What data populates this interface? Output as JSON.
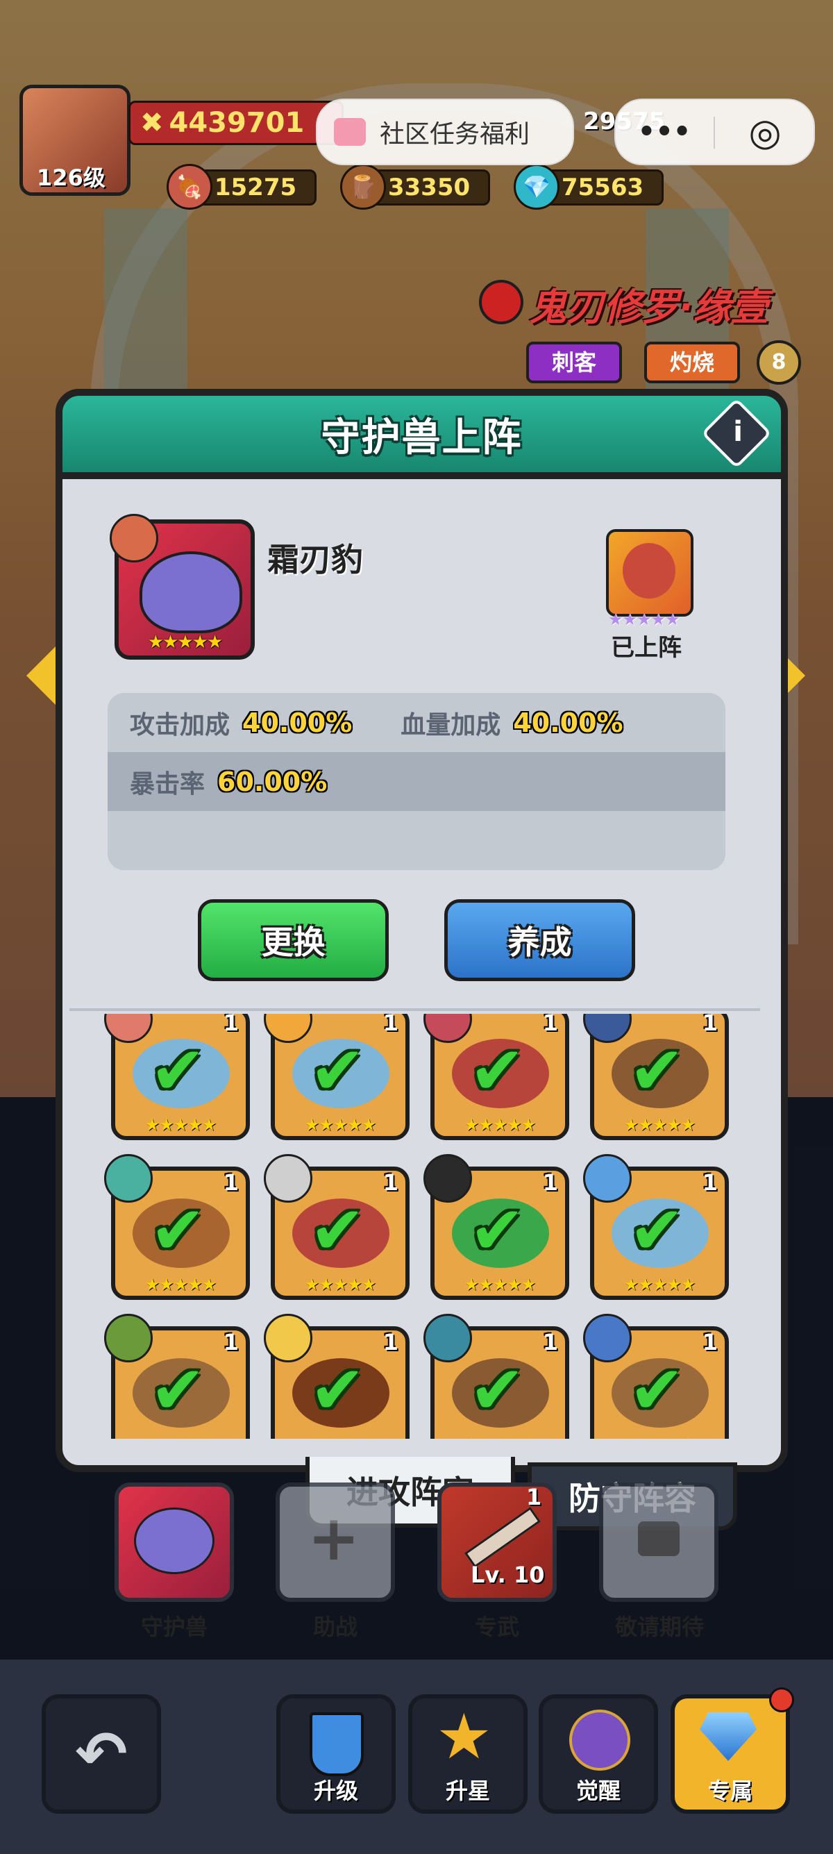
{
  "hud": {
    "level": "126级",
    "power": "4439701",
    "extra_value": "29575",
    "resources": [
      {
        "icon": "meat-icon",
        "value": "15275"
      },
      {
        "icon": "wood-log-icon",
        "value": "33350"
      },
      {
        "icon": "crystal-icon",
        "value": "75563"
      }
    ]
  },
  "capsule": {
    "title": "社区任务福利",
    "more": "•••",
    "close": "◎"
  },
  "hero": {
    "name": "鬼刃修罗·缘壹",
    "tags": [
      "刺客",
      "灼烧"
    ],
    "rank": "8"
  },
  "modal": {
    "title": "守护兽上阵",
    "info": "i",
    "beast": {
      "name": "霜刃豹",
      "stars": "★★★★★"
    },
    "deployed": {
      "label": "已上阵",
      "stars": "★★★★★"
    },
    "stats": [
      {
        "label": "攻击加成",
        "value": "40.00%"
      },
      {
        "label": "血量加成",
        "value": "40.00%"
      },
      {
        "label": "暴击率",
        "value": "60.00%"
      }
    ],
    "buttons": {
      "replace": "更换",
      "train": "养成"
    }
  },
  "grid": {
    "items": [
      {
        "monster": "blue-slug",
        "level": "1"
      },
      {
        "monster": "blue-slug",
        "level": "1"
      },
      {
        "monster": "red-lizard",
        "level": "1"
      },
      {
        "monster": "tree-stump",
        "level": "1"
      },
      {
        "monster": "boar",
        "level": "1"
      },
      {
        "monster": "red-lizard",
        "level": "1"
      },
      {
        "monster": "green-slime",
        "level": "1"
      },
      {
        "monster": "blue-slug",
        "level": "1"
      },
      {
        "monster": "owl",
        "level": "1"
      },
      {
        "monster": "beetle",
        "level": "1"
      },
      {
        "monster": "tree-stump",
        "level": "1"
      },
      {
        "monster": "owl",
        "level": "1"
      }
    ],
    "stars": "★★★★★"
  },
  "tabs": {
    "attack": "进攻阵容",
    "defense": "防守阵容"
  },
  "slots": [
    {
      "label": "守护兽"
    },
    {
      "label": "助战"
    },
    {
      "label": "专武",
      "level": "Lv. 10",
      "badge": "1"
    },
    {
      "label": "敬请期待"
    }
  ],
  "nav": {
    "back": "back-arrow-icon",
    "items": [
      {
        "label": "升级"
      },
      {
        "label": "升星"
      },
      {
        "label": "觉醒"
      },
      {
        "label": "专属"
      }
    ]
  },
  "colors": {
    "accent_teal": "#2bb69a",
    "green_button": "#35c45a",
    "blue_button": "#3f8de0",
    "gold": "#ffd43a"
  }
}
